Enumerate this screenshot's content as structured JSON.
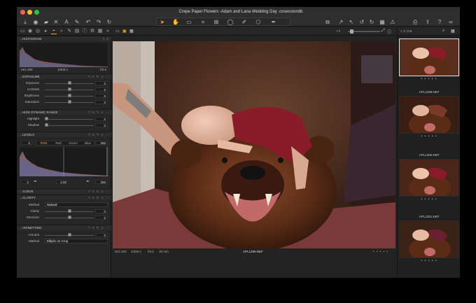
{
  "window": {
    "title": "Crepe Paper Flowers -Adam and Lana Wedding Day .cosessiondb"
  },
  "toolbar": {
    "left_icons": [
      "import-icon",
      "camera-icon",
      "folder-icon",
      "delete-icon",
      "text-icon",
      "brush-icon",
      "undo-icon",
      "redo-icon",
      "redo-alt-icon"
    ],
    "cursor_tools": [
      "pointer-icon",
      "pan-icon",
      "loupe-icon",
      "crop-icon",
      "keystone-icon",
      "spot-icon",
      "mask-brush-icon",
      "gradient-icon",
      "picker-icon"
    ],
    "right_icons": [
      "copy-icon",
      "apply-icon",
      "reset-icon",
      "rotate-icon",
      "grid-icon",
      "warning-icon"
    ],
    "far_right_icons": [
      "print-icon",
      "share-icon",
      "help-icon",
      "glasses-icon"
    ]
  },
  "left_panel": {
    "histogram": {
      "header": "HISTOGRAM",
      "iso": "ISO 200",
      "shutter": "1/200 s",
      "aperture": "f/3.5"
    },
    "exposure": {
      "header": "EXPOSURE",
      "sliders": [
        {
          "label": "Exposure",
          "value": "0",
          "level": 0.5
        },
        {
          "label": "Contrast",
          "value": "0",
          "level": 0.5
        },
        {
          "label": "Brightness",
          "value": "0",
          "level": 0.5
        },
        {
          "label": "Saturation",
          "value": "0",
          "level": 0.5
        }
      ]
    },
    "hdr": {
      "header": "HIGH DYNAMIC RANGE",
      "sliders": [
        {
          "label": "Highlight",
          "value": "0",
          "level": 0.0
        },
        {
          "label": "Shadow",
          "value": "0",
          "level": 0.0
        }
      ]
    },
    "levels": {
      "header": "LEVELS",
      "low_value": "0",
      "high_value": "255",
      "channels": [
        "RGB",
        "Red",
        "Green",
        "Blue"
      ],
      "active_channel": "RGB",
      "out_low": "0",
      "out_mid": "0.00",
      "out_high": "255"
    },
    "curve": {
      "header": "CURVE"
    },
    "clarity": {
      "header": "CLARITY",
      "method_label": "Method",
      "method_value": "Natural",
      "sliders": [
        {
          "label": "Clarity",
          "value": "0",
          "level": 0.5
        },
        {
          "label": "Structure",
          "value": "0",
          "level": 0.5
        }
      ]
    },
    "vignetting": {
      "header": "VIGNETTING",
      "amount_label": "Amount",
      "amount_value": "0",
      "amount_level": 0.5,
      "method_label": "Method",
      "method_value": "Elliptic on Crop"
    }
  },
  "viewer": {
    "zoom": "Fit",
    "page": "1 of 209",
    "meta_iso": "ISO 200",
    "meta_shutter": "1/200 s",
    "meta_aperture": "f/3.5",
    "meta_focal": "35 mm",
    "filename": "APL1299.NEF",
    "rating": "• • • • •"
  },
  "browser": {
    "thumbnails": [
      {
        "name": "",
        "rating": "• • • • •",
        "selected": true
      },
      {
        "name": "APL1299.NEF",
        "rating": "• • • • •",
        "selected": false
      },
      {
        "name": "APL1300.NEF",
        "rating": "• • • • •",
        "selected": false
      },
      {
        "name": "APL1301.NEF",
        "rating": "• • • • •",
        "selected": false
      }
    ],
    "captions": [
      "APL1299.NEF",
      "APL1300.NEF",
      "APL1301.NEF"
    ]
  },
  "colors": {
    "accent": "#f0a030",
    "panel": "#262626",
    "background": "#232323"
  }
}
